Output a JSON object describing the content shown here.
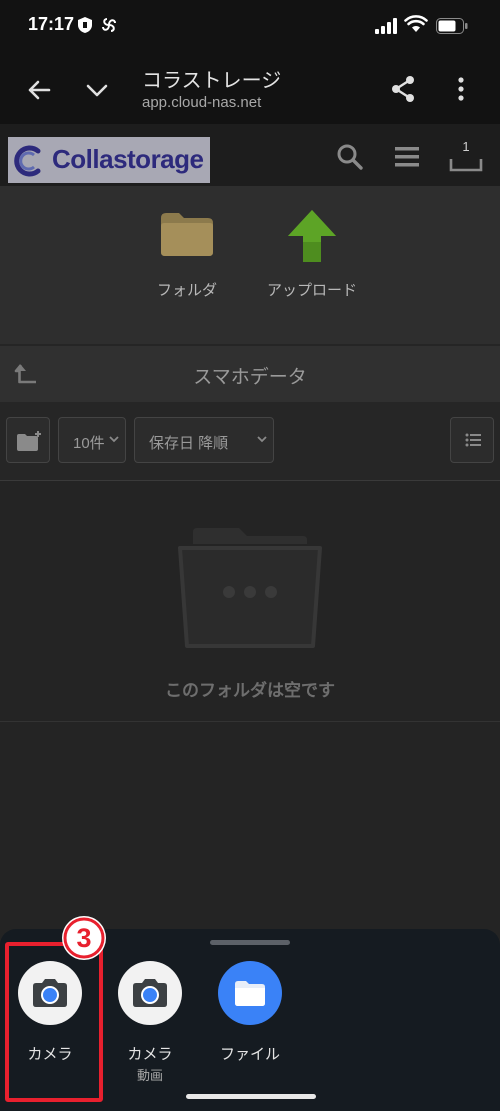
{
  "status_bar": {
    "time": "17:17"
  },
  "browser": {
    "title": "コラストレージ",
    "url": "app.cloud-nas.net"
  },
  "site": {
    "logo_text": "Collastorage",
    "inbox_count": "1"
  },
  "actions": [
    {
      "label": "フォルダ",
      "icon": "folder-icon"
    },
    {
      "label": "アップロード",
      "icon": "upload-arrow-icon"
    }
  ],
  "folder": {
    "title": "スマホデータ"
  },
  "toolbar": {
    "count": "10件",
    "sort": "保存日 降順"
  },
  "content": {
    "empty_message": "このフォルダは空です"
  },
  "sheet": {
    "apps": [
      {
        "label": "カメラ",
        "sublabel": "",
        "icon": "camera-icon"
      },
      {
        "label": "カメラ",
        "sublabel": "動画",
        "icon": "camera-icon"
      },
      {
        "label": "ファイル",
        "sublabel": "",
        "icon": "folder-icon"
      }
    ]
  },
  "annotation": {
    "step": "3"
  },
  "colors": {
    "highlight": "#e8202e",
    "files_blue": "#3a82f7",
    "upload_green": "#4e8d1f",
    "logo_blue": "#2d2a7c"
  }
}
